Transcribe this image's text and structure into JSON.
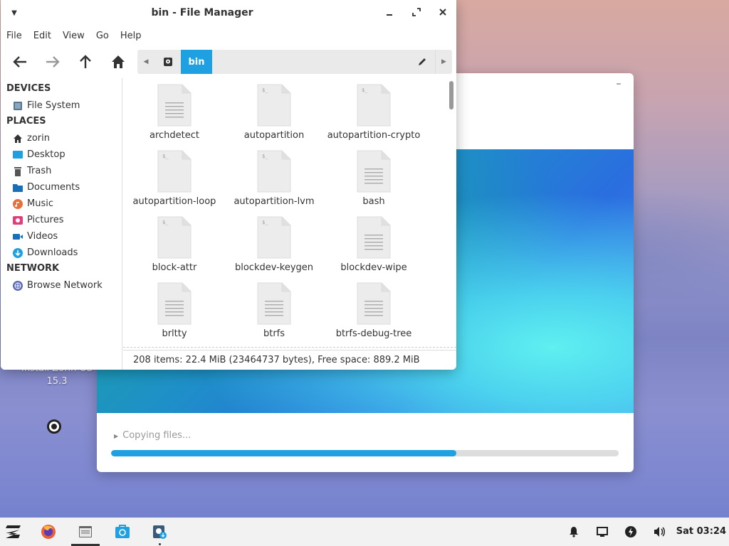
{
  "desktop": {
    "icon_label": "Install Zorin OS 15.3"
  },
  "installer": {
    "status_text": "Copying files...",
    "progress_fraction": 0.68
  },
  "file_manager": {
    "title": "bin - File Manager",
    "menu": [
      "File",
      "Edit",
      "View",
      "Go",
      "Help"
    ],
    "path_current": "bin",
    "sidebar": {
      "devices_heading": "DEVICES",
      "devices": [
        {
          "label": "File System",
          "icon": "drive-icon"
        }
      ],
      "places_heading": "PLACES",
      "places": [
        {
          "label": "zorin",
          "icon": "home-icon"
        },
        {
          "label": "Desktop",
          "icon": "desktop-icon"
        },
        {
          "label": "Trash",
          "icon": "trash-icon"
        },
        {
          "label": "Documents",
          "icon": "documents-icon"
        },
        {
          "label": "Music",
          "icon": "music-icon"
        },
        {
          "label": "Pictures",
          "icon": "pictures-icon"
        },
        {
          "label": "Videos",
          "icon": "videos-icon"
        },
        {
          "label": "Downloads",
          "icon": "downloads-icon"
        }
      ],
      "network_heading": "NETWORK",
      "network": [
        {
          "label": "Browse Network",
          "icon": "network-icon"
        }
      ]
    },
    "files": [
      {
        "name": "archdetect",
        "type": "text"
      },
      {
        "name": "autopartition",
        "type": "script"
      },
      {
        "name": "autopartition-crypto",
        "type": "script"
      },
      {
        "name": "autopartition-loop",
        "type": "script"
      },
      {
        "name": "autopartition-lvm",
        "type": "script"
      },
      {
        "name": "bash",
        "type": "text"
      },
      {
        "name": "block-attr",
        "type": "script"
      },
      {
        "name": "blockdev-keygen",
        "type": "script"
      },
      {
        "name": "blockdev-wipe",
        "type": "text"
      },
      {
        "name": "brltty",
        "type": "text"
      },
      {
        "name": "btrfs",
        "type": "text"
      },
      {
        "name": "btrfs-debug-tree",
        "type": "text"
      }
    ],
    "status": "208 items: 22.4 MiB (23464737 bytes), Free space: 889.2 MiB"
  },
  "taskbar": {
    "clock": "Sat 03:24",
    "colors": {
      "accent": "#1fa0e0"
    }
  }
}
